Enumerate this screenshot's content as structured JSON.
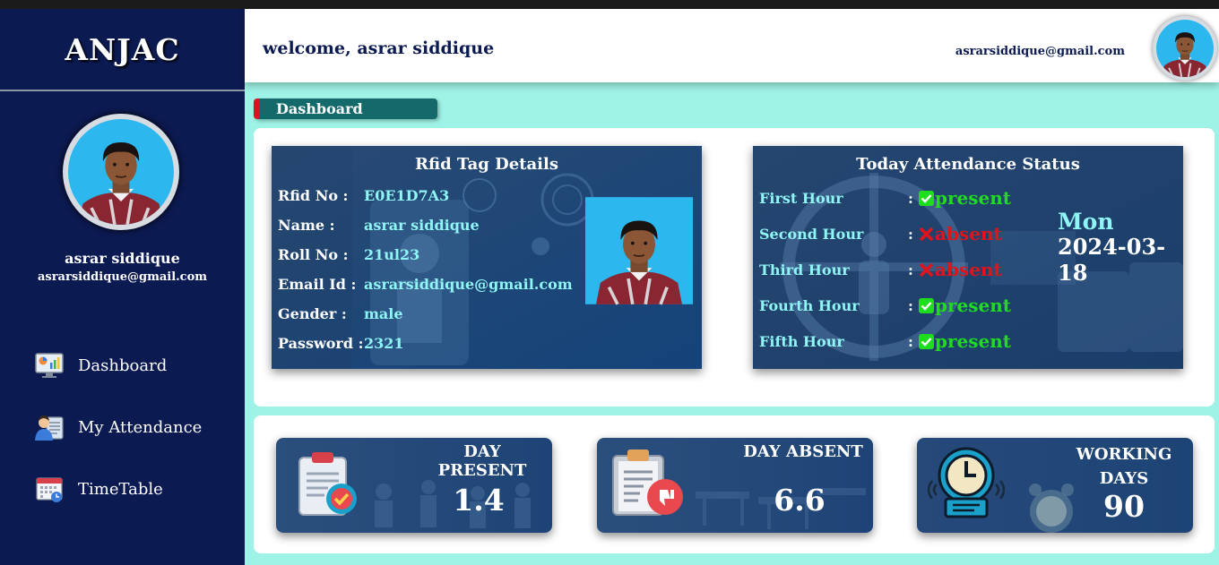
{
  "sidebar": {
    "brand": "ANJAC",
    "user_name": "asrar siddique",
    "user_email": "asrarsiddique@gmail.com",
    "nav": [
      {
        "label": "Dashboard",
        "icon": "dashboard-monitor-icon"
      },
      {
        "label": "My Attendance",
        "icon": "attendance-user-icon"
      },
      {
        "label": "TimeTable",
        "icon": "calendar-icon"
      }
    ]
  },
  "header": {
    "welcome": "welcome, asrar siddique",
    "email": "asrarsiddique@gmail.com"
  },
  "page": {
    "section_label": "Dashboard"
  },
  "rfid": {
    "title": "Rfid Tag Details",
    "fields": [
      {
        "label": "Rfid No :",
        "value": "E0E1D7A3"
      },
      {
        "label": "Name :",
        "value": "asrar siddique"
      },
      {
        "label": "Roll No :",
        "value": "21ul23"
      },
      {
        "label": "Email Id :",
        "value": "asrarsiddique@gmail.com"
      },
      {
        "label": "Gender :",
        "value": "male"
      },
      {
        "label": "Password :",
        "value": "2321"
      }
    ]
  },
  "attendance_today": {
    "title": "Today Attendance Status",
    "day": "Mon",
    "date": "2024-03-18",
    "hours": [
      {
        "label": "First Hour",
        "colon": ":",
        "status": "present"
      },
      {
        "label": "Second Hour",
        "colon": ":",
        "status": "absent"
      },
      {
        "label": "Third Hour",
        "colon": ":",
        "status": "absent"
      },
      {
        "label": "Fourth Hour",
        "colon": ":",
        "status": "present"
      },
      {
        "label": "Fifth Hour",
        "colon": ":",
        "status": "present"
      }
    ]
  },
  "stats": {
    "present": {
      "label": "DAY PRESENT",
      "value": "1.4",
      "icon": "clipboard-check-icon"
    },
    "absent": {
      "label": "DAY ABSENT",
      "value": "6.6",
      "icon": "clipboard-thumbs-down-icon"
    },
    "working": {
      "label_line1": "WORKING",
      "label_line2": "DAYS",
      "value": "90",
      "icon": "clock-icon"
    }
  },
  "colors": {
    "sidebar": "#0c1a52",
    "page_bg": "#9ff3e6",
    "present": "#1fdc1f",
    "absent": "#e0141a",
    "accent_teal": "#146a6a"
  }
}
